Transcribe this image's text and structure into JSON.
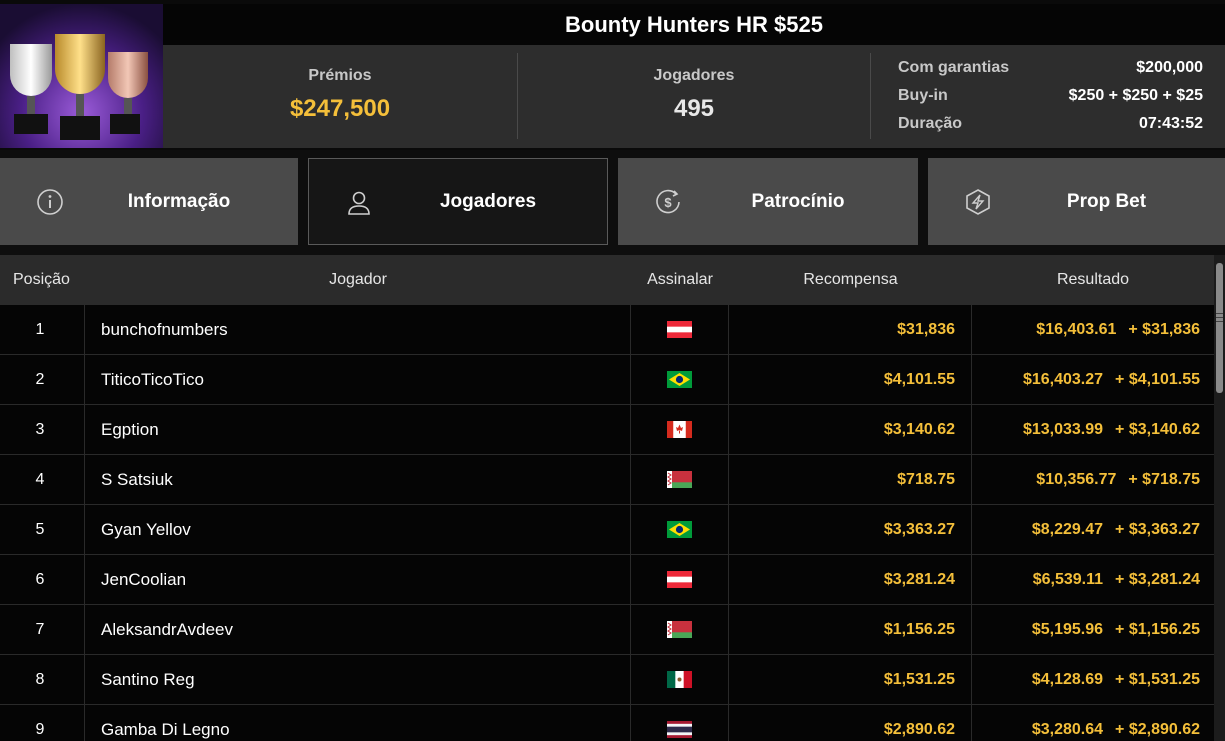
{
  "header": {
    "title": "Bounty Hunters HR $525",
    "prizes_label": "Prémios",
    "prizes_value": "$247,500",
    "players_label": "Jogadores",
    "players_value": "495",
    "details": [
      {
        "label": "Com garantias",
        "value": "$200,000"
      },
      {
        "label": "Buy-in",
        "value": "$250 + $250 + $25"
      },
      {
        "label": "Duração",
        "value": "07:43:52"
      }
    ]
  },
  "tabs": [
    {
      "label": "Informação",
      "icon": "info-icon"
    },
    {
      "label": "Jogadores",
      "icon": "user-icon",
      "active": true
    },
    {
      "label": "Patrocínio",
      "icon": "dollar-coin-icon"
    },
    {
      "label": "Prop Bet",
      "icon": "prop-bet-icon"
    }
  ],
  "table": {
    "headers": {
      "position": "Posição",
      "player": "Jogador",
      "flag": "Assinalar",
      "reward": "Recompensa",
      "result": "Resultado"
    },
    "rows": [
      {
        "pos": "1",
        "name": "bunchofnumbers",
        "flag": "austria",
        "reward": "$31,836",
        "result": "$16,403.61",
        "bonus": "+ $31,836"
      },
      {
        "pos": "2",
        "name": "TiticoTicoTico",
        "flag": "brazil",
        "reward": "$4,101.55",
        "result": "$16,403.27",
        "bonus": "+ $4,101.55"
      },
      {
        "pos": "3",
        "name": "Egption",
        "flag": "canada",
        "reward": "$3,140.62",
        "result": "$13,033.99",
        "bonus": "+ $3,140.62"
      },
      {
        "pos": "4",
        "name": "S Satsiuk",
        "flag": "belarus",
        "reward": "$718.75",
        "result": "$10,356.77",
        "bonus": "+ $718.75"
      },
      {
        "pos": "5",
        "name": "Gyan Yellov",
        "flag": "brazil",
        "reward": "$3,363.27",
        "result": "$8,229.47",
        "bonus": "+ $3,363.27"
      },
      {
        "pos": "6",
        "name": "JenCoolian",
        "flag": "austria",
        "reward": "$3,281.24",
        "result": "$6,539.11",
        "bonus": "+ $3,281.24"
      },
      {
        "pos": "7",
        "name": "AleksandrAvdeev",
        "flag": "belarus",
        "reward": "$1,156.25",
        "result": "$5,195.96",
        "bonus": "+ $1,156.25"
      },
      {
        "pos": "8",
        "name": "Santino Reg",
        "flag": "mexico",
        "reward": "$1,531.25",
        "result": "$4,128.69",
        "bonus": "+ $1,531.25"
      },
      {
        "pos": "9",
        "name": "Gamba Di Legno",
        "flag": "thailand",
        "reward": "$2,890.62",
        "result": "$3,280.64",
        "bonus": "+ $2,890.62"
      }
    ]
  },
  "colors": {
    "gold": "#f4bf3a",
    "tab_bg": "#4a4a4a",
    "tab_active_bg": "#161616",
    "stats_bg": "#2d2d2d"
  }
}
